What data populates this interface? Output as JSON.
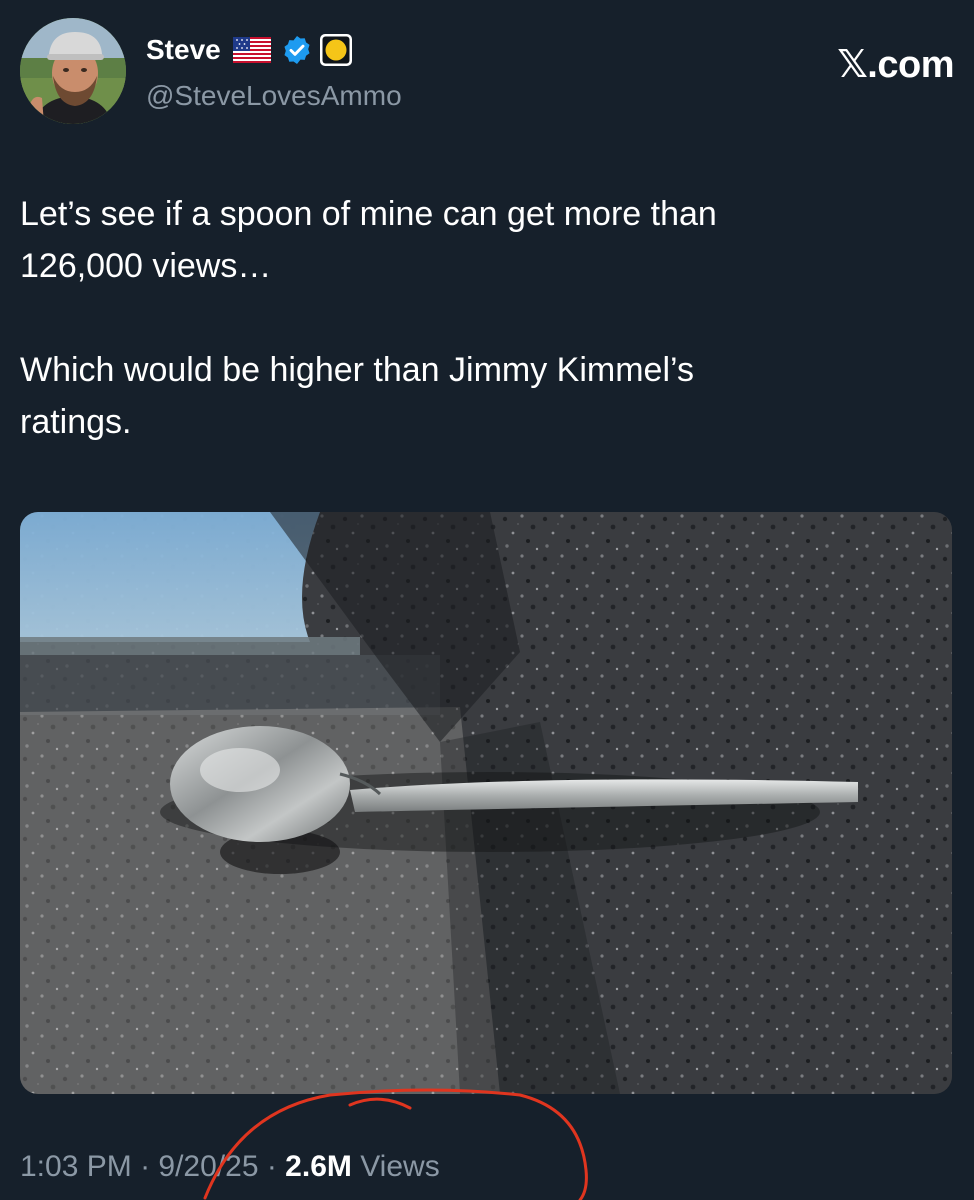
{
  "header": {
    "display_name": "Steve",
    "flag": "us-flag-emoji",
    "verified_badge": "verified-check-icon",
    "status_emoji": "yellow-circle-emoji",
    "handle": "@SteveLovesAmmo",
    "site_watermark": "𝕏.com"
  },
  "tweet": {
    "paragraphs": [
      "Let’s see if a spoon of mine can get more than\n126,000 views…",
      "Which would be higher than Jimmy Kimmel’s\nratings."
    ]
  },
  "media": {
    "photo_icon": "spoon-on-granite-photo"
  },
  "meta": {
    "time": "1:03 PM",
    "separator_1": " · ",
    "date": "9/20/25",
    "separator_2": " · ",
    "views_count": "2.6M",
    "views_label": " Views"
  },
  "colors": {
    "background": "#16202b",
    "text_primary": "#ffffff",
    "text_secondary": "#8b98a5",
    "verified_blue": "#1d9bf0",
    "annotation_red": "#e0351f"
  }
}
